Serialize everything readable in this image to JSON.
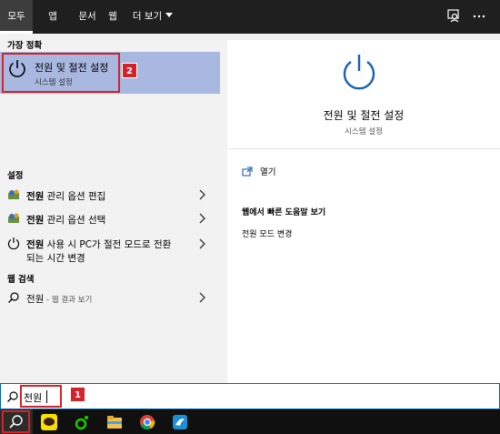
{
  "tabs": [
    "모두",
    "앱",
    "문서",
    "웹",
    "더 보기"
  ],
  "top_icons": [
    "feedback-icon",
    "more-options-icon"
  ],
  "left": {
    "best_match_label": "가장 정확",
    "best_match": {
      "title": "전원 및 절전 설정",
      "subtitle": "시스템 설정",
      "annotation": "2"
    },
    "settings_label": "설정",
    "settings_items": [
      {
        "bold": "전원",
        "rest": " 관리 옵션 편집"
      },
      {
        "bold": "전원",
        "rest": " 관리 옵션 선택"
      },
      {
        "bold": "전원",
        "rest": " 사용 시 PC가 절전 모드로 전환",
        "line2": "되는 시간 변경"
      }
    ],
    "web_label": "웹 검색",
    "web_item": {
      "bold": "전원",
      "sub": " - 웹 결과 보기"
    }
  },
  "right": {
    "title": "전원 및 절전 설정",
    "subtitle": "시스템 설정",
    "open_label": "열기",
    "web_heading": "웹에서 빠른 도움말 보기",
    "web_link": "전원 모드 변경"
  },
  "search": {
    "value": "전원",
    "annotation": "1"
  },
  "taskbar": [
    "search-icon",
    "kakaotalk-icon",
    "naver-whale-icon",
    "file-explorer-icon",
    "chrome-icon",
    "app-icon"
  ],
  "colors": {
    "accent": "#0063b1",
    "selection": "#a9b8e0",
    "annotation": "#d0232a",
    "power_blue": "#1a5fb4"
  }
}
